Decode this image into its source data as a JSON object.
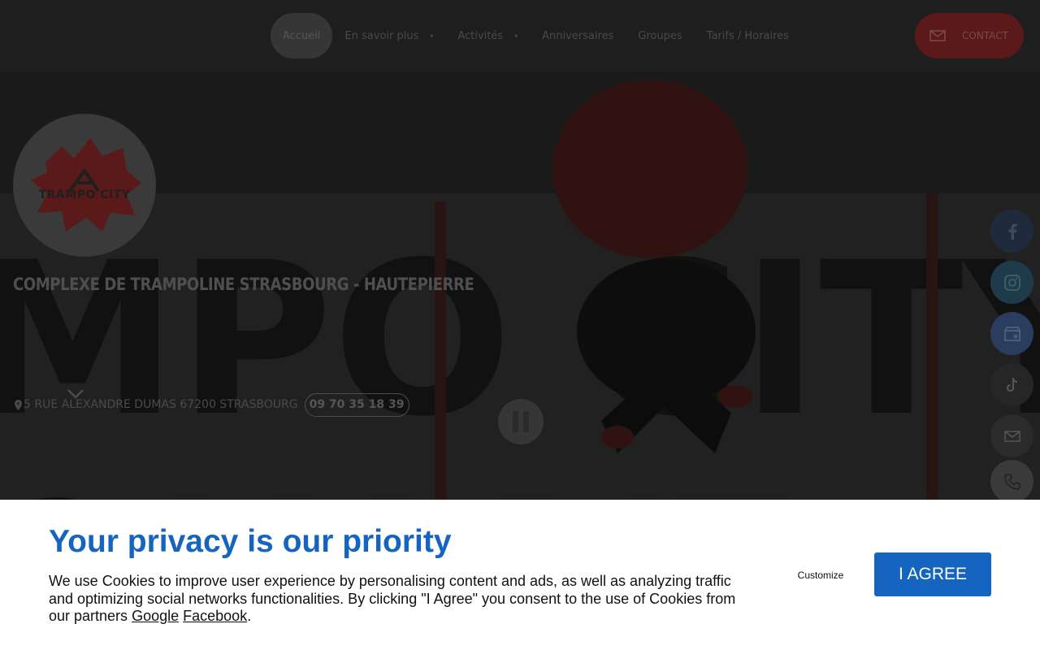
{
  "nav": {
    "items": [
      {
        "label": "Accueil",
        "active": true,
        "has_caret": false
      },
      {
        "label": "En savoir plus",
        "active": false,
        "has_caret": true
      },
      {
        "label": "Activités",
        "active": false,
        "has_caret": true
      },
      {
        "label": "Anniversaires",
        "active": false,
        "has_caret": false
      },
      {
        "label": "Groupes",
        "active": false,
        "has_caret": false
      },
      {
        "label": "Tarifs / Horaires",
        "active": false,
        "has_caret": false
      }
    ],
    "caret_glyph": "▾",
    "contact_label": "CONTACT",
    "contact_icon": "envelope-icon"
  },
  "brand": {
    "logo_text": "TRAMPO CITY"
  },
  "hero": {
    "headline": "COMPLEXE DE TRAMPOLINE STRASBOURG - HAUTEPIERRE",
    "address": "5 RUE ALEXANDRE DUMAS 67200 STRASBOURG",
    "phone": "09 70 35 18 39",
    "pause_icon": "pause-icon",
    "scroll_icon": "chevron-down-icon"
  },
  "social": [
    {
      "name": "facebook-icon",
      "color": "#1f2a3d"
    },
    {
      "name": "instagram-icon",
      "color": "#1f3a4a"
    },
    {
      "name": "google-business-icon",
      "color": "#2a3d5e"
    },
    {
      "name": "tiktok-icon",
      "color": "#262626"
    },
    {
      "name": "email-icon",
      "color": "#2b2b2b"
    },
    {
      "name": "phone-icon",
      "color": "#3a3a3a"
    }
  ],
  "cookie": {
    "title": "Your privacy is our priority",
    "text_before": "We use Cookies to improve user experience by personalising content and ads, as well as analyzing traffic and optimizing social networks functionalities. By clicking \"I Agree\" you consent to the use of Cookies from our partners",
    "link_google": "Google",
    "link_facebook": "Facebook",
    "text_after": ".",
    "customize_label": "Customize",
    "agree_label": "I AGREE",
    "accent_color": "#1565c0"
  }
}
